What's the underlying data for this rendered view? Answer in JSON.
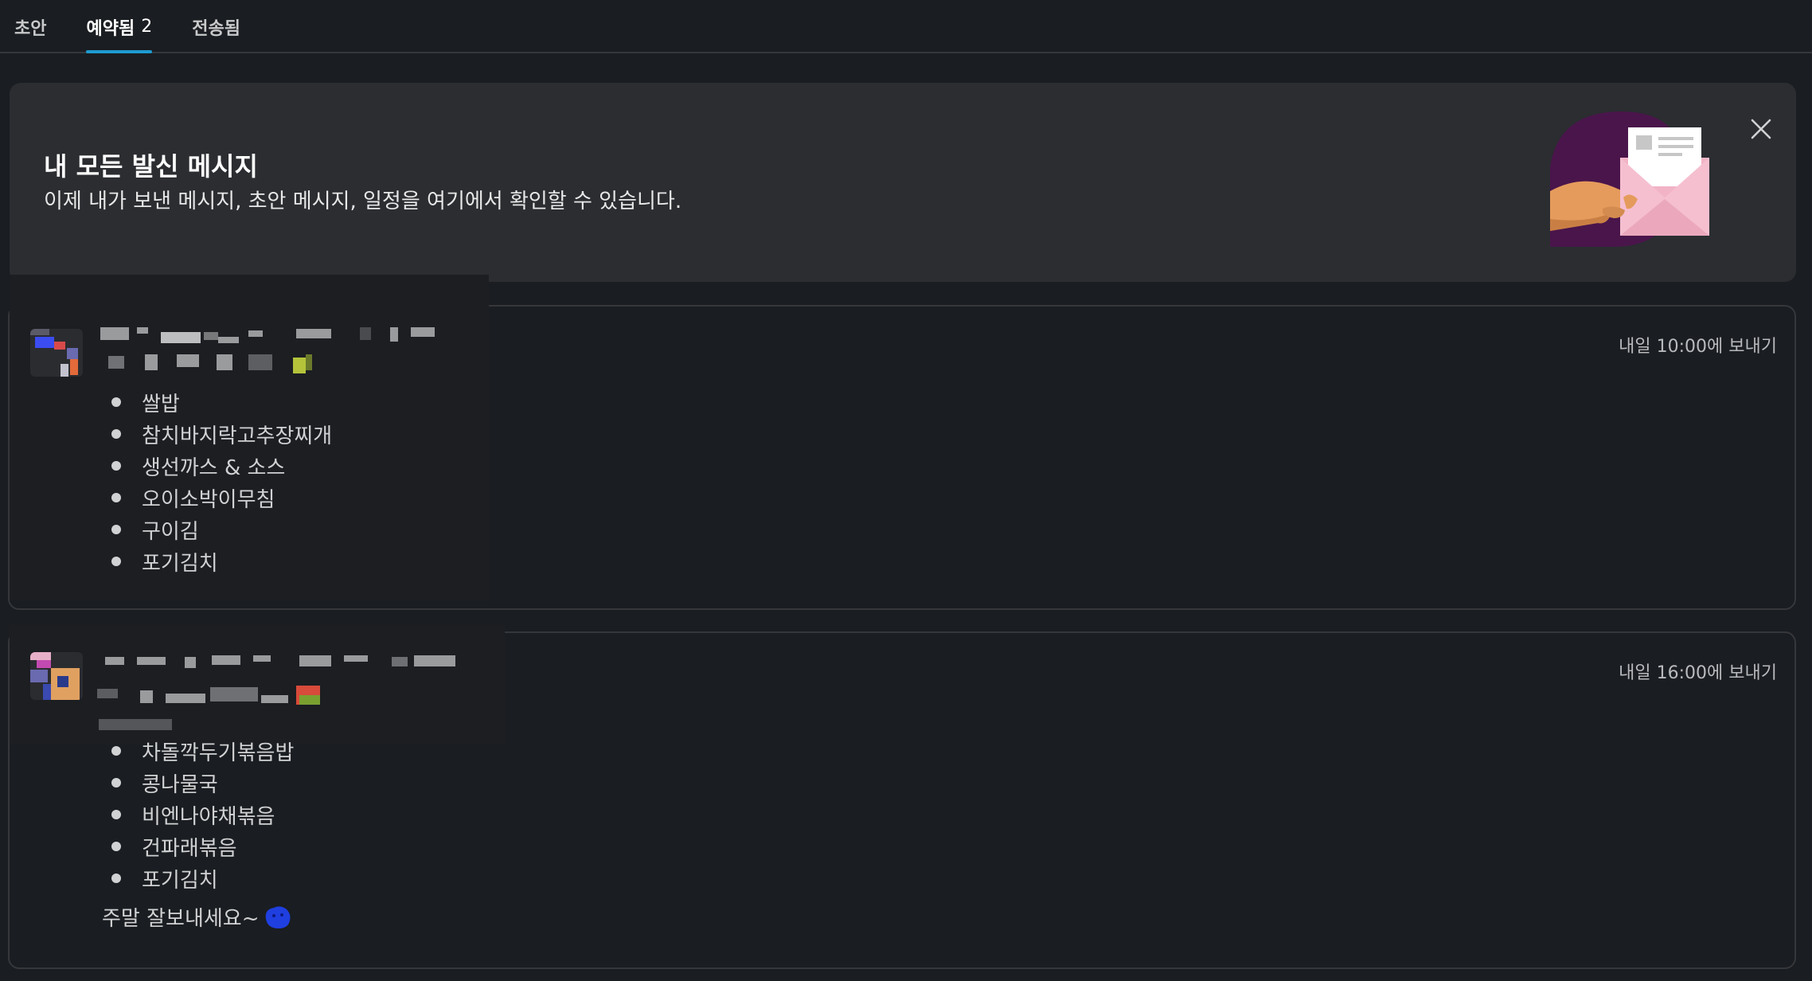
{
  "tabs": [
    {
      "label": "초안"
    },
    {
      "label": "예약됨",
      "count": "2"
    },
    {
      "label": "전송됨"
    }
  ],
  "banner": {
    "title": "내 모든 발신 메시지",
    "subtitle": "이제 내가 보낸 메시지, 초안 메시지, 일정을 여기에서 확인할 수 있습니다."
  },
  "messages": [
    {
      "send_time": "내일 10:00에 보내기",
      "items": [
        "쌀밥",
        "참치바지락고추장찌개",
        "생선까스 & 소스",
        "오이소박이무침",
        "구이김",
        "포기김치"
      ]
    },
    {
      "send_time": "내일 16:00에 보내기",
      "items": [
        "차돌깍두기볶음밥",
        "콩나물국",
        "비엔나야채볶음",
        "건파래볶음",
        "포기김치"
      ],
      "closing": "주말 잘보내세요~"
    }
  ],
  "colors": {
    "accent": "#1d9bd1",
    "background": "#1a1d21",
    "banner": "#2b2d31",
    "illustration_purple": "#4a154b"
  }
}
